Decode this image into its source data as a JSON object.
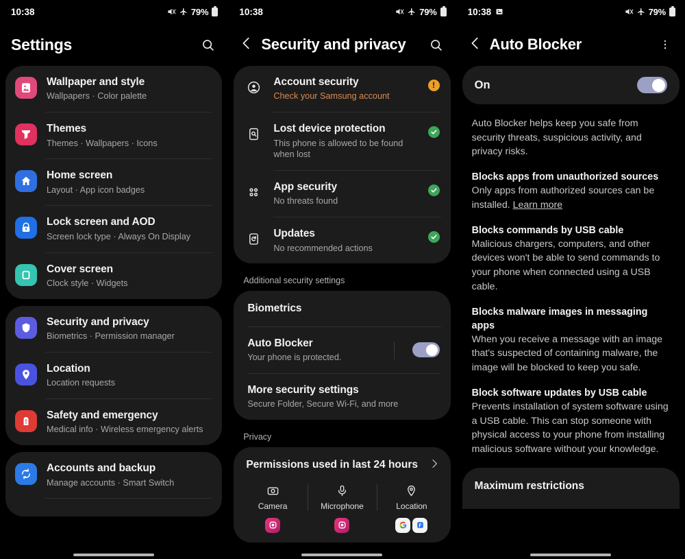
{
  "status_bar": {
    "time": "10:38",
    "battery_percent": "79%",
    "icons": [
      "mute-icon",
      "airplane-mode-icon",
      "battery-icon"
    ],
    "panel3_extra_icon": "screenshot-icon"
  },
  "colors": {
    "background": "#000000",
    "card": "#1c1c1c",
    "primary_text": "#f2f2f2",
    "secondary_text": "#a8a8a8",
    "warning": "#d98a54",
    "warning_badge": "#eda028",
    "success": "#3ea55a",
    "toggle_on": "#9ba0c4",
    "accent_pink": "#e04a7a",
    "accent_blue": "#3a76e8",
    "accent_teal": "#35c4b0",
    "accent_indigo": "#5b5ce0",
    "accent_red": "#dd3b34"
  },
  "panel1": {
    "title": "Settings",
    "search_icon": "search-icon",
    "groups": [
      {
        "items": [
          {
            "title": "Wallpaper and style",
            "subtitle": "Wallpapers  ·  Color palette",
            "icon": "wallpaper-icon",
            "icon_color": "#e04a7a"
          },
          {
            "title": "Themes",
            "subtitle": "Themes  ·  Wallpapers  ·  Icons",
            "icon": "themes-icon",
            "icon_color": "#e0315f"
          },
          {
            "title": "Home screen",
            "subtitle": "Layout  ·  App icon badges",
            "icon": "home-icon",
            "icon_color": "#2f6fe0"
          },
          {
            "title": "Lock screen and AOD",
            "subtitle": "Screen lock type  ·  Always On Display",
            "icon": "lock-icon",
            "icon_color": "#1f6fe5"
          },
          {
            "title": "Cover screen",
            "subtitle": "Clock style  ·  Widgets",
            "icon": "cover-screen-icon",
            "icon_color": "#35c4b0"
          }
        ]
      },
      {
        "items": [
          {
            "title": "Security and privacy",
            "subtitle": "Biometrics  ·  Permission manager",
            "icon": "shield-icon",
            "icon_color": "#5b5ce0"
          },
          {
            "title": "Location",
            "subtitle": "Location requests",
            "icon": "location-pin-icon",
            "icon_color": "#4a53e0"
          },
          {
            "title": "Safety and emergency",
            "subtitle": "Medical info  ·  Wireless emergency alerts",
            "icon": "emergency-icon",
            "icon_color": "#dd3b34"
          }
        ]
      },
      {
        "items": [
          {
            "title": "Accounts and backup",
            "subtitle": "Manage accounts  ·  Smart Switch",
            "icon": "sync-icon",
            "icon_color": "#2b7ae5"
          }
        ]
      }
    ]
  },
  "panel2": {
    "title": "Security and privacy",
    "back_icon": "chevron-left-icon",
    "search_icon": "search-icon",
    "status_items": [
      {
        "title": "Account security",
        "subtitle": "Check your Samsung account",
        "subtitle_state": "warning",
        "icon": "account-circle-icon",
        "badge": "warning"
      },
      {
        "title": "Lost device protection",
        "subtitle": "This phone is allowed to be found when lost",
        "subtitle_state": "normal",
        "icon": "find-device-icon",
        "badge": "ok"
      },
      {
        "title": "App security",
        "subtitle": "No threats found",
        "subtitle_state": "normal",
        "icon": "app-grid-icon",
        "badge": "ok"
      },
      {
        "title": "Updates",
        "subtitle": "No recommended actions",
        "subtitle_state": "normal",
        "icon": "update-icon",
        "badge": "ok"
      }
    ],
    "section_additional": "Additional security settings",
    "additional_items": [
      {
        "title": "Biometrics",
        "subtitle": ""
      },
      {
        "title": "Auto Blocker",
        "subtitle": "Your phone is protected.",
        "toggle": "on"
      },
      {
        "title": "More security settings",
        "subtitle": "Secure Folder, Secure Wi-Fi, and more"
      }
    ],
    "section_privacy": "Privacy",
    "permissions": {
      "title": "Permissions used in last 24 hours",
      "arrow_icon": "chevron-right-icon",
      "cells": [
        {
          "label": "Camera",
          "icon": "camera-icon",
          "apps": [
            "instagram-icon"
          ]
        },
        {
          "label": "Microphone",
          "icon": "microphone-icon",
          "apps": [
            "instagram-icon"
          ]
        },
        {
          "label": "Location",
          "icon": "location-pin-icon",
          "apps": [
            "google-icon",
            "flipkart-icon"
          ]
        }
      ]
    }
  },
  "panel3": {
    "title": "Auto Blocker",
    "back_icon": "chevron-left-icon",
    "menu_icon": "more-vertical-icon",
    "toggle_label": "On",
    "toggle_state": "on",
    "intro": "Auto Blocker helps keep you safe from security threats, suspicious activity, and privacy risks.",
    "sections": [
      {
        "heading": "Blocks apps from unauthorized sources",
        "body": "Only apps from authorized sources can be installed. ",
        "link": "Learn more"
      },
      {
        "heading": "Blocks commands by USB cable",
        "body": "Malicious chargers, computers, and other devices won't be able to send commands to your phone when connected using a USB cable.",
        "link": ""
      },
      {
        "heading": "Blocks malware images in messaging apps",
        "body": "When you receive a message with an image that's suspected of containing malware, the image will be blocked to keep you safe.",
        "link": ""
      },
      {
        "heading": "Block software updates by USB cable",
        "body": "Prevents installation of system software using a USB cable. This can stop someone with physical access to your phone from installing malicious software without your knowledge.",
        "link": ""
      }
    ],
    "max_restrictions": "Maximum restrictions"
  }
}
